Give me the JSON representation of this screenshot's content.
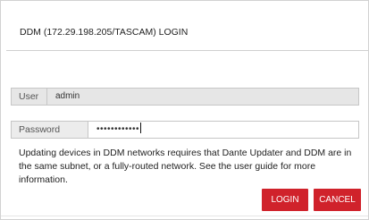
{
  "dialog": {
    "title": "DDM (172.29.198.205/TASCAM) LOGIN",
    "user": {
      "label": "User",
      "value": "admin"
    },
    "password": {
      "label": "Password",
      "value": "••••••••••••"
    },
    "message": "Updating devices in DDM networks requires that Dante Updater and DDM are in the same subnet, or a fully-routed network. See the user guide for more information.",
    "buttons": {
      "login": "LOGIN",
      "cancel": "CANCEL"
    },
    "colors": {
      "button_bg": "#d0222b",
      "button_text": "#ffffff"
    }
  }
}
